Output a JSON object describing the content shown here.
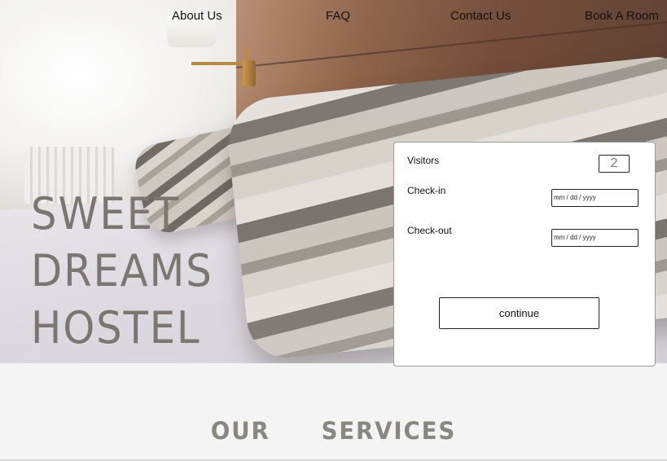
{
  "nav": {
    "about": "About Us",
    "faq": "FAQ",
    "contact": "Contact Us",
    "book": "Book A Room"
  },
  "hero": {
    "title_lines": [
      "SWEET",
      "DREAMS",
      "HOSTEL"
    ]
  },
  "booking": {
    "visitors_label": "Visitors",
    "visitors_value": "2",
    "checkin_label": "Check-in",
    "checkin_placeholder": "mm / dd / yyyy",
    "checkout_label": "Check-out",
    "checkout_placeholder": "mm / dd / yyyy",
    "continue_label": "continue"
  },
  "services": {
    "title": "OUR   SERVICES"
  }
}
